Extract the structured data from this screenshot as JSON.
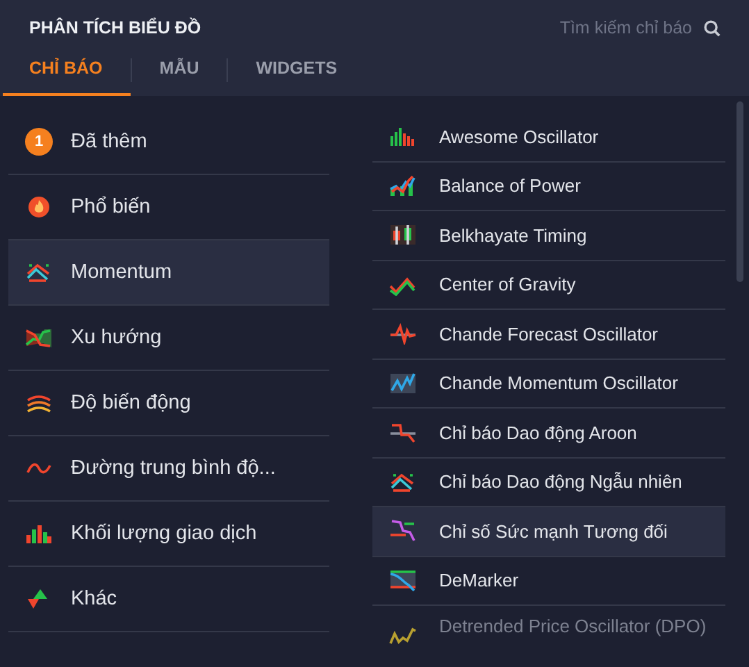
{
  "header": {
    "title": "PHÂN TÍCH BIỂU ĐỒ",
    "search": {
      "placeholder": "Tìm kiếm chỉ báo"
    }
  },
  "tabs": [
    {
      "label": "CHỈ BÁO",
      "selected": true
    },
    {
      "label": "MẪU",
      "selected": false
    },
    {
      "label": "WIDGETS",
      "selected": false
    }
  ],
  "categories": [
    {
      "label": "Đã thêm",
      "badge": "1",
      "selected": false
    },
    {
      "label": "Phổ biến",
      "selected": false
    },
    {
      "label": "Momentum",
      "selected": true
    },
    {
      "label": "Xu hướng",
      "selected": false
    },
    {
      "label": "Độ biến động",
      "selected": false
    },
    {
      "label": "Đường trung bình độ...",
      "selected": false
    },
    {
      "label": "Khối lượng giao dịch",
      "selected": false
    },
    {
      "label": "Khác",
      "selected": false
    }
  ],
  "indicators": [
    {
      "label": "Awesome Oscillator",
      "selected": false
    },
    {
      "label": "Balance of Power",
      "selected": false
    },
    {
      "label": "Belkhayate Timing",
      "selected": false
    },
    {
      "label": "Center of Gravity",
      "selected": false
    },
    {
      "label": "Chande Forecast Oscillator",
      "selected": false
    },
    {
      "label": "Chande Momentum Oscillator",
      "selected": false
    },
    {
      "label": "Chỉ báo Dao động Aroon",
      "selected": false
    },
    {
      "label": "Chỉ báo Dao động Ngẫu nhiên",
      "selected": false
    },
    {
      "label": "Chỉ số Sức mạnh Tương đối",
      "selected": true
    },
    {
      "label": "DeMarker",
      "selected": false
    },
    {
      "label": "Detrended Price Oscillator (DPO)",
      "selected": false,
      "dimmed": true
    }
  ]
}
